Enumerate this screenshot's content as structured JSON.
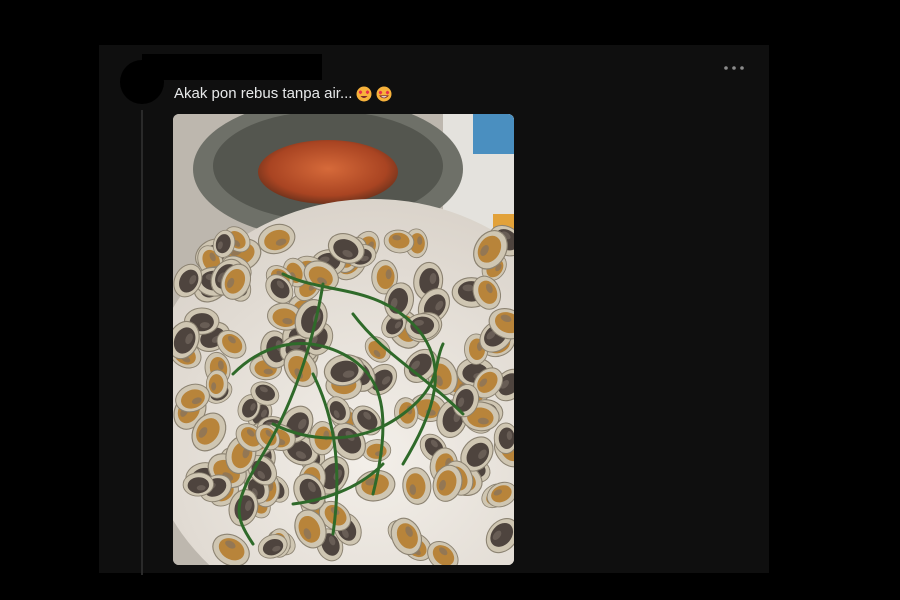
{
  "post": {
    "text": "Akak pon rebus tanpa air...",
    "emojis": [
      "heart-eyes-smiling-face",
      "heart-eyes-grinning-face"
    ],
    "more_icon": "more-horizontal-icon",
    "image_description_icon": "photo"
  },
  "colors": {
    "background": "#000000",
    "card": "#0f0f0f",
    "text": "#e7e9ea",
    "muted": "#8b8b8b"
  }
}
